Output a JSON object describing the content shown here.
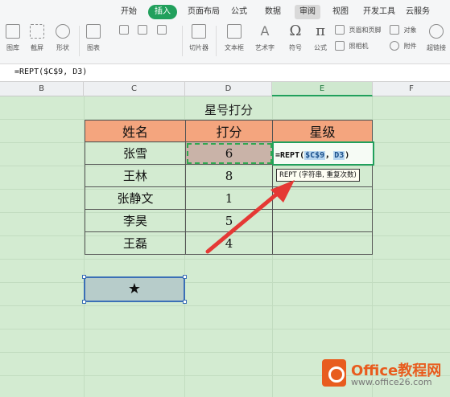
{
  "ribbon": {
    "tabs": [
      "开始",
      "插入",
      "页面布局",
      "公式",
      "数据",
      "审阅",
      "视图",
      "开发工具",
      "云服务"
    ],
    "active_tab": "插入",
    "tools": {
      "picture": "图库",
      "screenshot": "截屏",
      "shapes": "形状",
      "chart": "图表",
      "slicer": "切片器",
      "textbox": "文本框",
      "wordart": "艺术字",
      "symbol": "符号",
      "formula": "公式",
      "header_footer": "页眉和页脚",
      "object": "对象",
      "camera": "照相机",
      "attachment": "附件",
      "hyperlink": "超链接"
    },
    "symbol_glyph": "Ω",
    "formula_glyph": "π"
  },
  "formula_bar": {
    "content": "=REPT($C$9, D3)"
  },
  "columns": [
    "B",
    "C",
    "D",
    "E",
    "F"
  ],
  "sheet": {
    "title": "星号打分",
    "headers": [
      "姓名",
      "打分",
      "星级"
    ],
    "rows": [
      {
        "name": "张雪",
        "score": "6"
      },
      {
        "name": "王林",
        "score": "8"
      },
      {
        "name": "张静文",
        "score": "1"
      },
      {
        "name": "李昊",
        "score": "5"
      },
      {
        "name": "王磊",
        "score": "4"
      }
    ],
    "editing_formula": {
      "prefix": "=REPT(",
      "ref1": "$C$9",
      "sep": "，",
      "ref2": "D3",
      "suffix": ")"
    },
    "tooltip": "REPT (字符串, 重复次数)",
    "star": "★"
  },
  "watermark": {
    "brand": "Office教程网",
    "url": "www.office26.com"
  },
  "colors": {
    "accent": "#21a05c",
    "header_fill": "#f4a57e",
    "grid_bg": "#d3ebd1",
    "arrow": "#e53935"
  }
}
